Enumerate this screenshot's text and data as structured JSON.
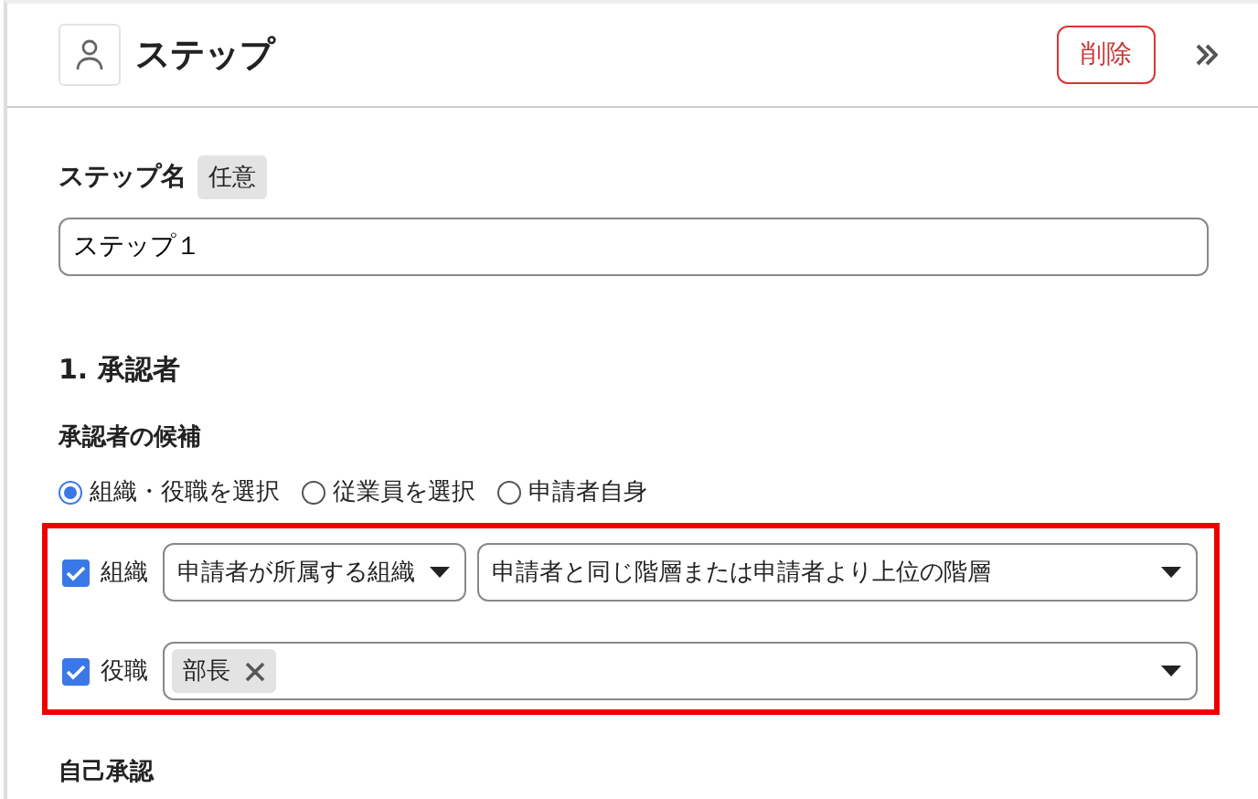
{
  "header": {
    "title": "ステップ",
    "delete_button": "削除"
  },
  "step_name": {
    "label": "ステップ名",
    "badge": "任意",
    "value": "ステップ１"
  },
  "section": {
    "title": "1. 承認者",
    "subtitle": "承認者の候補"
  },
  "radios": [
    {
      "label": "組織・役職を選択",
      "selected": true
    },
    {
      "label": "従業員を選択",
      "selected": false
    },
    {
      "label": "申請者自身",
      "selected": false
    }
  ],
  "conditions": [
    {
      "label": "組織",
      "checked": true,
      "selects": [
        "申請者が所属する組織",
        "申請者と同じ階層または申請者より上位の階層"
      ]
    },
    {
      "label": "役職",
      "checked": true,
      "tags": [
        "部長"
      ]
    }
  ],
  "next_section": "自己承認"
}
